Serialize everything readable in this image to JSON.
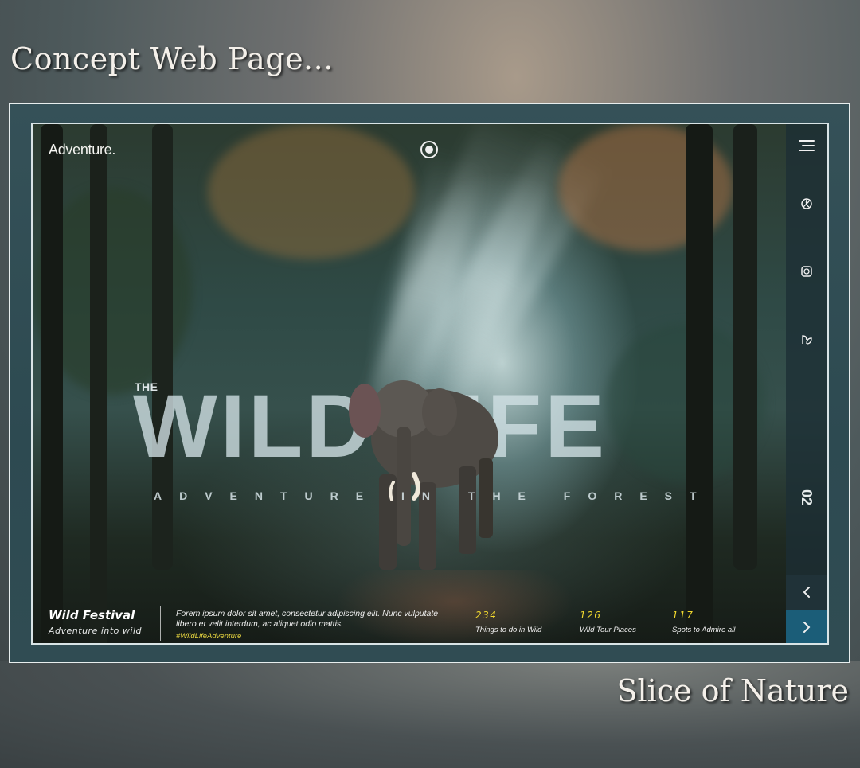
{
  "caption": {
    "heading": "Concept Web Page...",
    "footer": "Slice of Nature"
  },
  "header": {
    "brand": "Adventure."
  },
  "hero": {
    "pre_title": "THE",
    "title": "WILD LIFE",
    "subtitle": "ADVENTURE IN THE FOREST"
  },
  "sidebar": {
    "icons": [
      "menu-icon",
      "leaf-icon",
      "instagram-icon",
      "plant-icon"
    ],
    "slide_number": "02"
  },
  "bottom": {
    "festival_title": "Wild Festival",
    "festival_subtitle": "Adventure into wild",
    "description": "Forem ipsum dolor sit amet, consectetur adipiscing elit. Nunc vulputate libero et velit interdum, ac aliquet odio mattis.",
    "hashtag": "#WildLifeAdventure",
    "stats": [
      {
        "value": "234",
        "label": "Things to do in Wild"
      },
      {
        "value": "126",
        "label": "Wild Tour Places"
      },
      {
        "value": "117",
        "label": "Spots to Admire all"
      }
    ]
  },
  "colors": {
    "accent_yellow": "#f1d82e",
    "nav_next": "#1b5d78"
  }
}
